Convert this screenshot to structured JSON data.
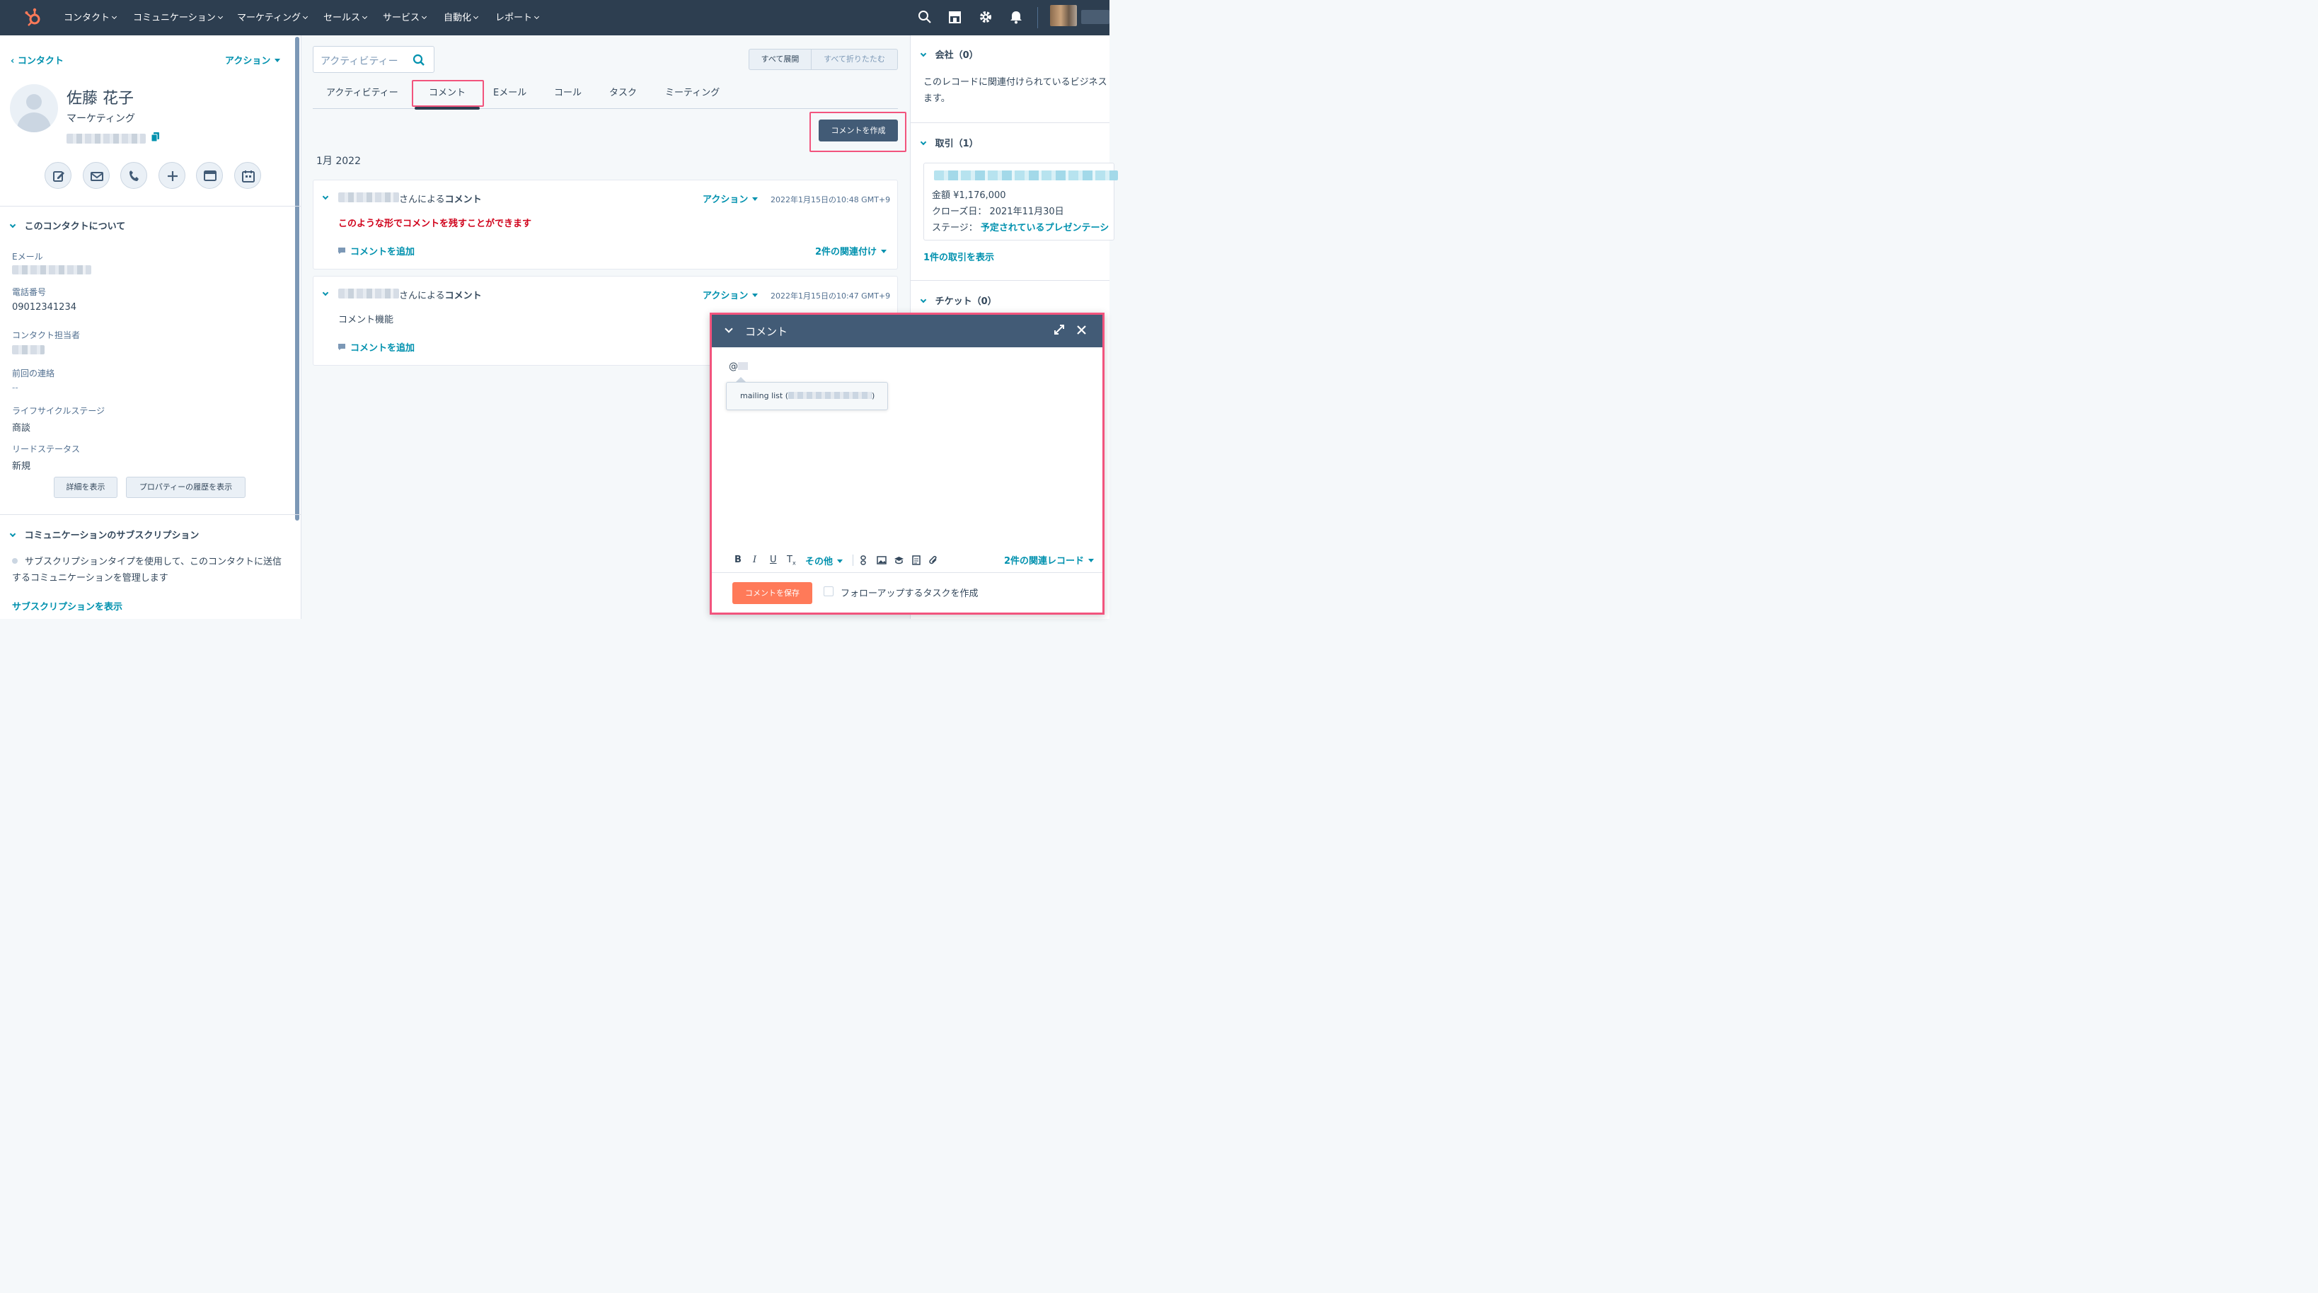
{
  "topnav": {
    "items": [
      "コンタクト",
      "コミュニケーション",
      "マーケティング",
      "セールス",
      "サービス",
      "自動化",
      "レポート"
    ]
  },
  "contact": {
    "back_link": "コンタクト",
    "actions_label": "アクション",
    "name": "佐藤 花子",
    "department": "マーケティング",
    "about_section": "このコンタクトについて",
    "properties": [
      {
        "label": "Eメール",
        "value": ""
      },
      {
        "label": "電話番号",
        "value": "09012341234"
      },
      {
        "label": "コンタクト担当者",
        "value": ""
      },
      {
        "label": "前回の連絡",
        "value": "--"
      },
      {
        "label": "ライフサイクルステージ",
        "value": "商談"
      },
      {
        "label": "リードステータス",
        "value": "新規"
      }
    ],
    "details_button": "詳細を表示",
    "history_button": "プロパティーの履歴を表示",
    "subscription_section": "コミュニケーションのサブスクリプション",
    "subscription_text": "サブスクリプションタイプを使用して、このコンタクトに送信するコミュニケーションを管理します",
    "subscription_link": "サブスクリプションを表示"
  },
  "activity": {
    "search_placeholder": "アクティビティー",
    "expand_all": "すべて展開",
    "collapse_all": "すべて折りたたむ",
    "tabs": [
      "アクティビティー",
      "コメント",
      "Eメール",
      "コール",
      "タスク",
      "ミーティング"
    ],
    "create_comment_button": "コメントを作成",
    "month_label": "1月 2022",
    "comments": [
      {
        "by_suffix": "さんによる",
        "type": "コメント",
        "actions": "アクション",
        "timestamp": "2022年1月15日の10:48 GMT+9",
        "body": "このような形でコメントを残すことができます",
        "add_comment": "コメントを追加",
        "associations": "2件の関連付け"
      },
      {
        "by_suffix": "さんによる",
        "type": "コメント",
        "actions": "アクション",
        "timestamp": "2022年1月15日の10:47 GMT+9",
        "body": "コメント機能",
        "add_comment": "コメントを追加"
      }
    ]
  },
  "sidebar": {
    "company_header": "会社（0）",
    "company_text": "このレコードに関連付けられているビジネスます。",
    "deal_header": "取引（1）",
    "deal_amount": "金額 ¥1,176,000",
    "deal_close_date": "クローズ日： 2021年11月30日",
    "deal_stage_label": "ステージ：",
    "deal_stage_value": "予定されているプレゼンテーシ",
    "deal_link": "1件の取引を表示",
    "ticket_header": "チケット（0）"
  },
  "modal": {
    "title": "コメント",
    "mention_text": "@",
    "mention_suggestion_prefix": "mailing list (",
    "mention_suggestion_suffix": ")",
    "toolbar_more": "その他",
    "related_records": "2件の関連レコード",
    "save_button": "コメントを保存",
    "followup_label": "フォローアップするタスクを作成"
  },
  "colors": {
    "nav": "#2d3e50",
    "link": "#0091ae",
    "accent": "#ff7a59",
    "highlight": "#f2547d",
    "comment_red": "#d0021b"
  }
}
